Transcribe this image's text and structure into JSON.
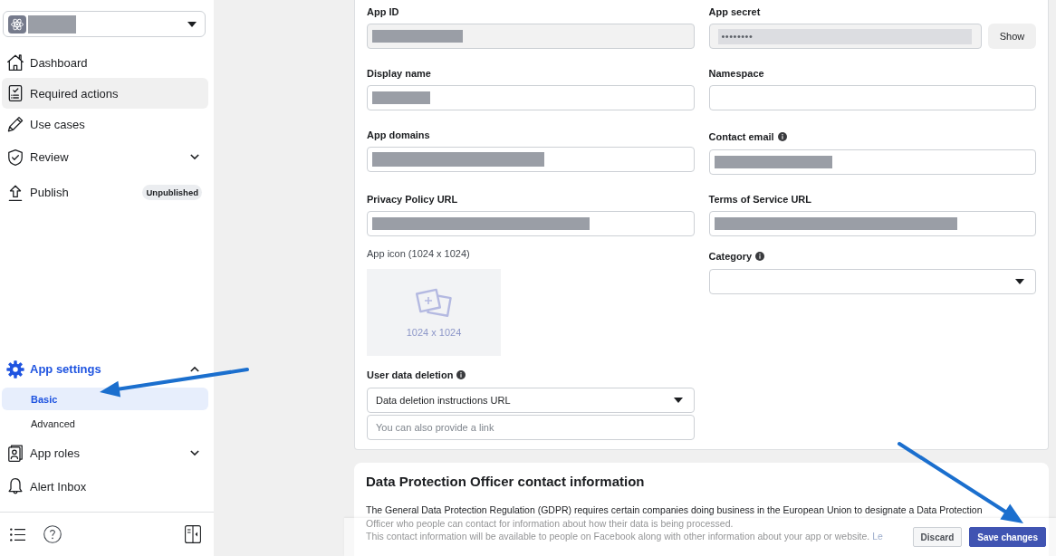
{
  "app_selector": {
    "redacted": true
  },
  "sidebar": {
    "primary": [
      {
        "label": "Dashboard",
        "hovered": false
      },
      {
        "label": "Required actions",
        "hovered": true
      },
      {
        "label": "Use cases",
        "hovered": false
      },
      {
        "label": "Review",
        "hovered": false,
        "expanded": false
      },
      {
        "label": "Publish",
        "hovered": false,
        "badge": "Unpublished"
      }
    ],
    "secondary": [
      {
        "label": "App settings",
        "hovered": false,
        "expanded": true,
        "children": [
          {
            "label": "Basic",
            "selected": true
          },
          {
            "label": "Advanced",
            "selected": false
          }
        ]
      },
      {
        "label": "App roles",
        "hovered": false,
        "expanded": false
      },
      {
        "label": "Alert Inbox",
        "hovered": false
      }
    ]
  },
  "basic_settings": {
    "fields": [
      {
        "kind": "text",
        "label": "App ID",
        "info": false,
        "disabled": true,
        "redacted": true
      },
      {
        "kind": "secret",
        "label": "App secret",
        "info": false,
        "disabled": true,
        "value": "••••••••",
        "button": "Show"
      },
      {
        "kind": "text",
        "label": "Display name",
        "info": false,
        "disabled": false,
        "redacted": true
      },
      {
        "kind": "text",
        "label": "Namespace",
        "info": false,
        "disabled": false,
        "redacted": false
      },
      {
        "kind": "text",
        "label": "App domains",
        "info": false,
        "disabled": false,
        "redacted": true
      },
      {
        "kind": "text",
        "label": "Contact email",
        "info": true,
        "disabled": false,
        "redacted": true
      },
      {
        "kind": "text",
        "label": "Privacy Policy URL",
        "info": false,
        "disabled": false,
        "redacted": true
      },
      {
        "kind": "text",
        "label": "Terms of Service URL",
        "info": false,
        "disabled": false,
        "redacted": true
      }
    ],
    "app_icon": {
      "label": "App icon (1024 x 1024)",
      "caption": "1024 x 1024"
    },
    "user_data_deletion": {
      "label": "User data deletion",
      "info": true,
      "option": "Data deletion instructions URL",
      "placeholder": "You can also provide a link"
    },
    "category": {
      "label": "Category",
      "info": true
    }
  },
  "dpo_section": {
    "title": "Data Protection Officer contact information",
    "paragraphs": [
      {
        "text": "The General Data Protection Regulation (GDPR) requires certain companies doing business in the European Union to designate a Data Protection Officer who people can contact for information about how their data is being processed."
      },
      {
        "text": "This contact information will be available to people on Facebook along with other information about your app or website.",
        "link": "Le"
      }
    ]
  },
  "footer": {
    "buttons": [
      {
        "label": "Discard",
        "kind": "secondary"
      },
      {
        "label": "Save changes",
        "kind": "primary"
      }
    ]
  }
}
